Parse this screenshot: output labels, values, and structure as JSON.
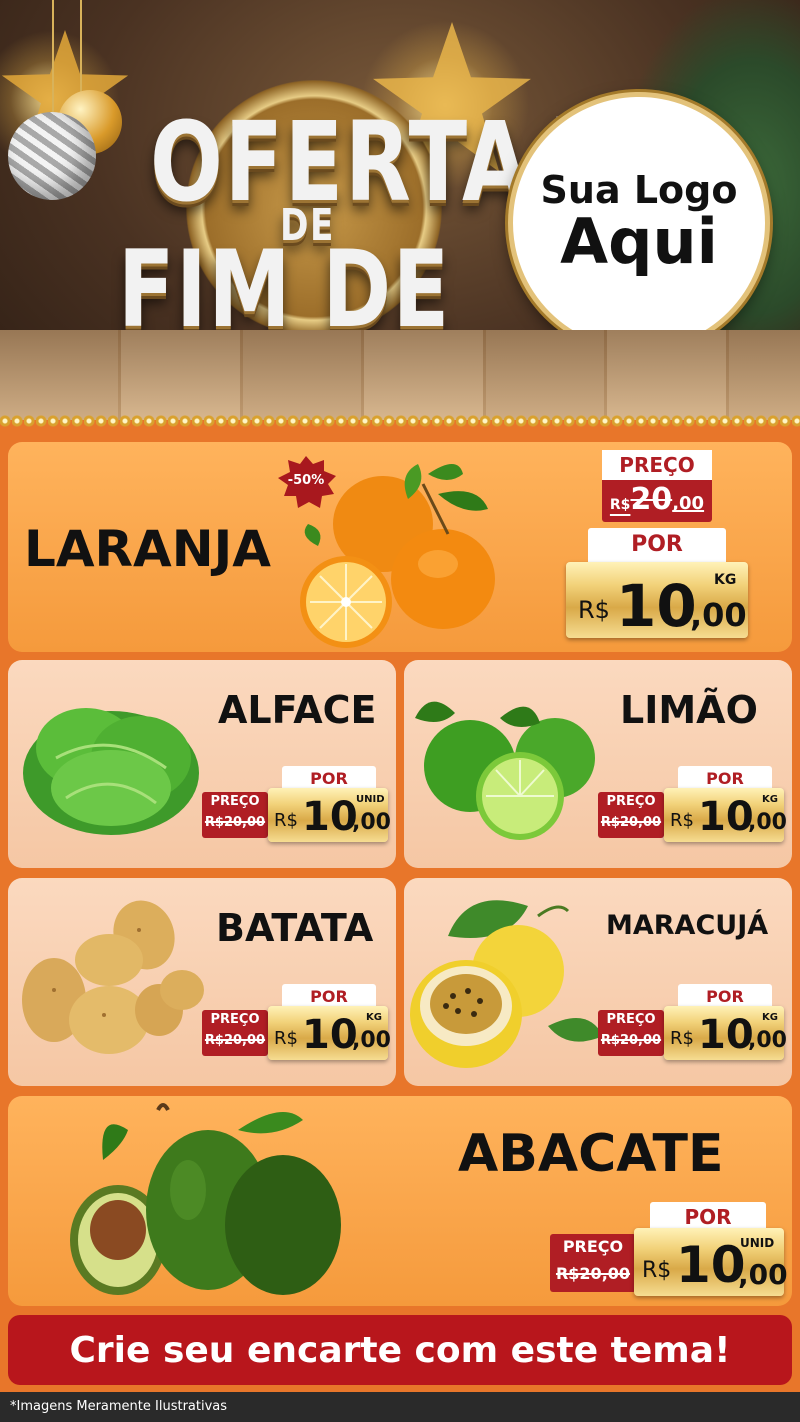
{
  "header": {
    "title_line1": "OFERTA$",
    "title_line2": "DE",
    "title_line3": "FIM DE ANO",
    "logo_line1": "Sua Logo",
    "logo_line2": "Aqui"
  },
  "featured": {
    "name": "LARANJA",
    "badge": "-50%",
    "old_label": "PREÇO",
    "old_currency": "R$",
    "old_int": "20",
    "old_dec": ",00",
    "por_label": "POR",
    "currency": "R$",
    "price_int": "10",
    "price_dec": ",00",
    "unit": "KG"
  },
  "products": [
    {
      "name": "ALFACE",
      "old_label": "PREÇO",
      "old_price": "R$20,00",
      "por_label": "POR",
      "currency": "R$",
      "price_int": "10",
      "price_dec": ",00",
      "unit": "UNID"
    },
    {
      "name": "LIMÃO",
      "old_label": "PREÇO",
      "old_price": "R$20,00",
      "por_label": "POR",
      "currency": "R$",
      "price_int": "10",
      "price_dec": ",00",
      "unit": "KG"
    },
    {
      "name": "BATATA",
      "old_label": "PREÇO",
      "old_price": "R$20,00",
      "por_label": "POR",
      "currency": "R$",
      "price_int": "10",
      "price_dec": ",00",
      "unit": "KG"
    },
    {
      "name": "MARACUJÁ",
      "old_label": "PREÇO",
      "old_price": "R$20,00",
      "por_label": "POR",
      "currency": "R$",
      "price_int": "10",
      "price_dec": ",00",
      "unit": "KG"
    }
  ],
  "bottom": {
    "name": "ABACATE",
    "old_label": "PREÇO",
    "old_price": "R$20,00",
    "por_label": "POR",
    "currency": "R$",
    "price_int": "10",
    "price_dec": ",00",
    "unit": "UNID"
  },
  "cta": "Crie seu encarte com este tema!",
  "disclaimer": "*Imagens Meramente Ilustrativas",
  "colors": {
    "red": "#b8161c",
    "orange": "#f59a3c",
    "gold": "#e3c27a"
  }
}
